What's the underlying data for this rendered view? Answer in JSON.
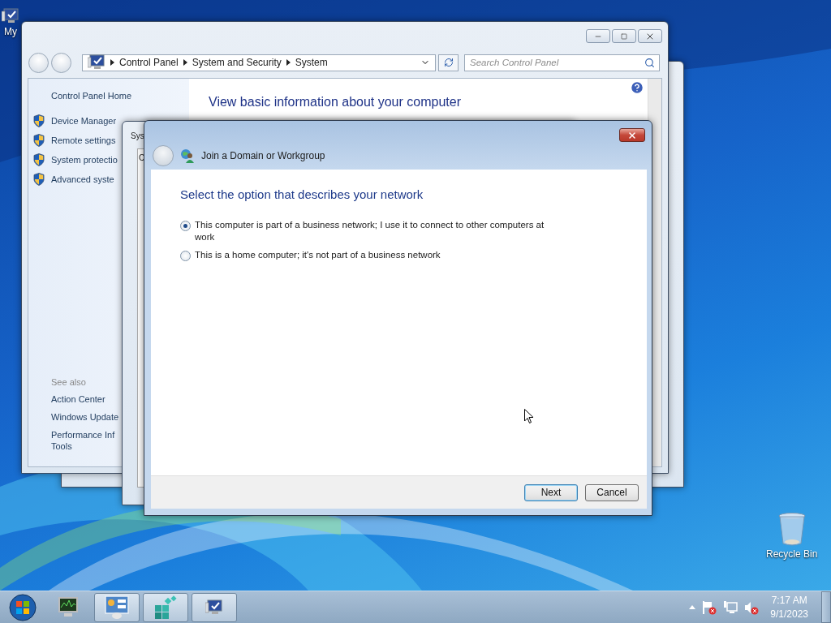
{
  "desktop": {
    "icons": [
      {
        "kind": "computer",
        "label": "My"
      },
      {
        "kind": "recycle",
        "label": "Recycle Bin"
      }
    ]
  },
  "background_window": {
    "title": "Sys",
    "field": "C"
  },
  "control_panel": {
    "breadcrumb": [
      "Control Panel",
      "System and Security",
      "System"
    ],
    "search": {
      "placeholder": "Search Control Panel"
    },
    "sidebar": {
      "home": "Control Panel Home",
      "tasks": [
        "Device Manager",
        "Remote settings",
        "System protectio",
        "Advanced syste"
      ],
      "see_also_title": "See also",
      "see_also": [
        [
          "Action Center"
        ],
        [
          "Windows Update"
        ],
        [
          "Performance Inf",
          "Tools"
        ]
      ]
    },
    "heading": "View basic information about your computer"
  },
  "dialog": {
    "title": "Join a Domain or Workgroup",
    "heading": "Select the option that describes your network",
    "options": [
      {
        "label": "This computer is part of a business network; I use it to connect to other computers at work",
        "selected": true
      },
      {
        "label": "This is a home computer; it's not part of a business network",
        "selected": false
      }
    ],
    "buttons": [
      {
        "label": "Next",
        "default": true
      },
      {
        "label": "Cancel",
        "default": false
      }
    ]
  },
  "taskbar": {
    "buttons": [
      {
        "kind": "monitor",
        "running": false
      },
      {
        "kind": "panel",
        "running": true
      },
      {
        "kind": "cubes",
        "running": true
      },
      {
        "kind": "computer",
        "running": true
      }
    ],
    "clock": {
      "time": "7:17 AM",
      "date": "9/1/2023"
    }
  }
}
